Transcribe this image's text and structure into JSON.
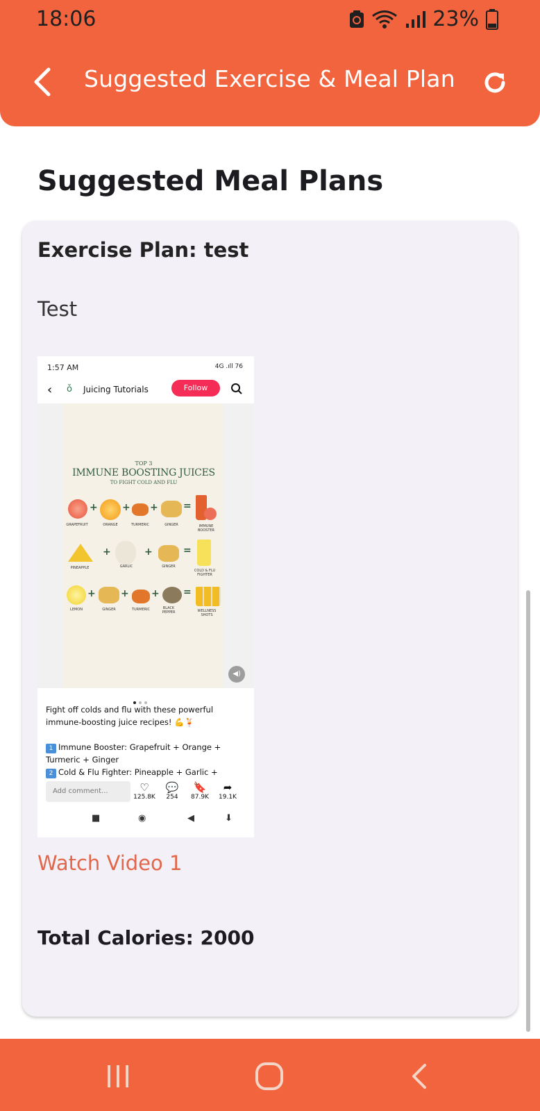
{
  "status_bar": {
    "time": "18:06",
    "battery": "23%"
  },
  "header": {
    "title": "Suggested Exercise & Meal Plan"
  },
  "section": {
    "title": "Suggested Meal Plans"
  },
  "card": {
    "title": "Exercise Plan: test",
    "description": "Test",
    "watch_link": "Watch Video 1",
    "total_calories": "Total Calories: 2000"
  },
  "embedded_screenshot": {
    "time": "1:57 AM",
    "status_right": "4G .ıll 76",
    "account_name": "Juicing Tutorials",
    "follow_label": "Follow",
    "poster": {
      "top_label": "TOP 3",
      "headline": "IMMUNE BOOSTING JUICES",
      "subline": "TO FIGHT COLD AND FLU",
      "row1": [
        "GRAPEFRUIT",
        "ORANGE",
        "TURMERIC",
        "GINGER",
        "IMMUNE BOOSTER"
      ],
      "row2": [
        "PINEAPPLE",
        "GARLIC",
        "GINGER",
        "COLD & FLU FIGHTER"
      ],
      "row3": [
        "LEMON",
        "GINGER",
        "TURMERIC",
        "BLACK PEPPER",
        "WELLNESS SHOTS"
      ]
    },
    "caption_line1": "Fight off colds and flu with these powerful immune-boosting juice recipes! 💪🍹",
    "caption_line2": "Immune Booster: Grapefruit + Orange + Turmeric + Ginger",
    "caption_line3": "Cold & Flu Fighter: Pineapple + Garlic +",
    "badge1": "1",
    "badge2": "2",
    "comment_placeholder": "Add comment...",
    "likes": "125.8K",
    "comments": "254",
    "saves": "87.9K",
    "shares": "19.1K"
  }
}
